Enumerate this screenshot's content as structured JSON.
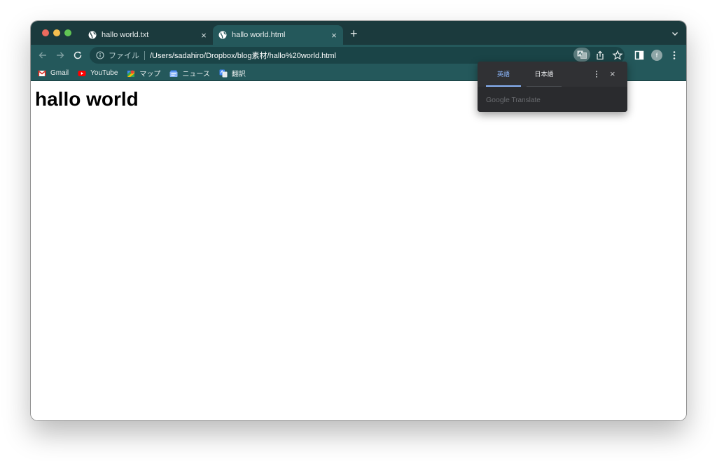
{
  "tabs": [
    {
      "title": "hallo world.txt",
      "active": false,
      "close": "×"
    },
    {
      "title": "hallo world.html",
      "active": true,
      "close": "×"
    }
  ],
  "new_tab_label": "+",
  "address_bar": {
    "scheme_label": "ファイル",
    "url": "/Users/sadahiro/Dropbox/blog素材/hallo%20world.html"
  },
  "profile_initial": "f",
  "bookmarks": [
    {
      "label": "Gmail",
      "icon": "gmail-icon"
    },
    {
      "label": "YouTube",
      "icon": "youtube-icon"
    },
    {
      "label": "マップ",
      "icon": "maps-icon"
    },
    {
      "label": "ニュース",
      "icon": "news-icon"
    },
    {
      "label": "翻訳",
      "icon": "translate-icon"
    }
  ],
  "page": {
    "heading": "hallo world"
  },
  "translate_popup": {
    "languages": [
      "英語",
      "日本語"
    ],
    "selected_language": "英語",
    "brand_google": "Google",
    "brand_translate": "Translate",
    "close": "×"
  },
  "colors": {
    "tabstrip": "#1b3a3d",
    "toolbar": "#24585b",
    "popup": "#303134",
    "accent": "#8ab4f8"
  }
}
